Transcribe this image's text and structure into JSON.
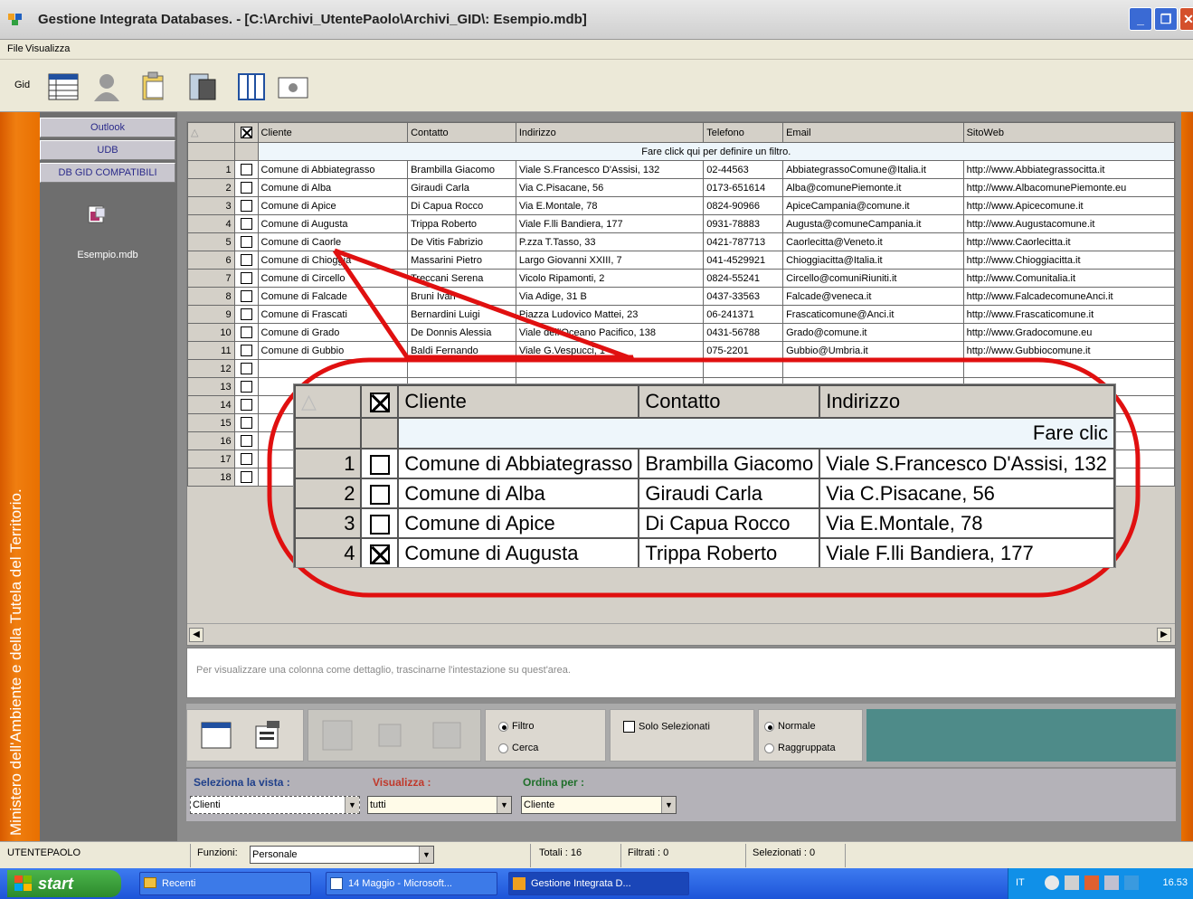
{
  "window": {
    "title": "Gestione Integrata Databases. - [C:\\Archivi_UtentePaolo\\Archivi_GID\\: Esempio.mdb]"
  },
  "menu": {
    "file": "File",
    "view": "Visualizza"
  },
  "toolbar": {
    "label": "Gid"
  },
  "sidebar": {
    "vertical_text": "Ministero dell'Ambiente e della Tutela del Territorio.",
    "buttons": [
      "Outlook",
      "UDB",
      "DB GID COMPATIBILI"
    ],
    "db_name": "Esempio.mdb"
  },
  "grid": {
    "columns": [
      "Cliente",
      "Contatto",
      "Indirizzo",
      "Telefono",
      "Email",
      "SitoWeb"
    ],
    "filter_text": "Fare click qui per definire un filtro.",
    "rows": [
      {
        "n": "1",
        "checked": false,
        "cliente": "Comune di Abbiategrasso",
        "contatto": "Brambilla Giacomo",
        "indirizzo": "Viale S.Francesco D'Assisi, 132",
        "telefono": "02-44563",
        "email": "AbbiategrassoComune@Italia.it",
        "sito": "http://www.Abbiategrassocitta.it"
      },
      {
        "n": "2",
        "checked": false,
        "cliente": "Comune di Alba",
        "contatto": "Giraudi Carla",
        "indirizzo": "Via C.Pisacane, 56",
        "telefono": "0173-651614",
        "email": "Alba@comunePiemonte.it",
        "sito": "http://www.AlbacomunePiemonte.eu"
      },
      {
        "n": "3",
        "checked": false,
        "cliente": "Comune di Apice",
        "contatto": "Di Capua Rocco",
        "indirizzo": "Via E.Montale, 78",
        "telefono": "0824-90966",
        "email": "ApiceCampania@comune.it",
        "sito": "http://www.Apicecomune.it"
      },
      {
        "n": "4",
        "checked": false,
        "cliente": "Comune di Augusta",
        "contatto": "Trippa Roberto",
        "indirizzo": "Viale F.lli Bandiera, 177",
        "telefono": "0931-78883",
        "email": "Augusta@comuneCampania.it",
        "sito": "http://www.Augustacomune.it"
      },
      {
        "n": "5",
        "checked": false,
        "cliente": "Comune di Caorle",
        "contatto": "De Vitis Fabrizio",
        "indirizzo": "P.zza T.Tasso, 33",
        "telefono": "0421-787713",
        "email": "Caorlecitta@Veneto.it",
        "sito": "http://www.Caorlecitta.it"
      },
      {
        "n": "6",
        "checked": false,
        "cliente": "Comune di Chioggia",
        "contatto": "Massarini Pietro",
        "indirizzo": "Largo Giovanni XXIII, 7",
        "telefono": "041-4529921",
        "email": "Chioggiacitta@Italia.it",
        "sito": "http://www.Chioggiacitta.it"
      },
      {
        "n": "7",
        "checked": false,
        "cliente": "Comune di Circello",
        "contatto": "Treccani Serena",
        "indirizzo": "Vicolo Ripamonti, 2",
        "telefono": "0824-55241",
        "email": "Circello@comuniRiuniti.it",
        "sito": "http://www.Comunitalia.it"
      },
      {
        "n": "8",
        "checked": false,
        "cliente": "Comune di Falcade",
        "contatto": "Bruni Ivan",
        "indirizzo": "Via Adige, 31 B",
        "telefono": "0437-33563",
        "email": "Falcade@veneca.it",
        "sito": "http://www.FalcadecomuneAnci.it"
      },
      {
        "n": "9",
        "checked": false,
        "cliente": "Comune di Frascati",
        "contatto": "Bernardini Luigi",
        "indirizzo": "Piazza Ludovico Mattei, 23",
        "telefono": "06-241371",
        "email": "Frascaticomune@Anci.it",
        "sito": "http://www.Frascaticomune.it"
      },
      {
        "n": "10",
        "checked": false,
        "cliente": "Comune di Grado",
        "contatto": "De Donnis Alessia",
        "indirizzo": "Viale dell'Oceano Pacifico, 138",
        "telefono": "0431-56788",
        "email": "Grado@comune.it",
        "sito": "http://www.Gradocomune.eu"
      },
      {
        "n": "11",
        "checked": false,
        "cliente": "Comune di Gubbio",
        "contatto": "Baldi Fernando",
        "indirizzo": "Viale G.Vespucci, 1",
        "telefono": "075-2201",
        "email": "Gubbio@Umbria.it",
        "sito": "http://www.Gubbiocomune.it"
      },
      {
        "n": "12",
        "checked": false,
        "cliente": "",
        "contatto": "",
        "indirizzo": "",
        "telefono": "",
        "email": "",
        "sito": ""
      },
      {
        "n": "13",
        "checked": false,
        "cliente": "",
        "contatto": "",
        "indirizzo": "",
        "telefono": "",
        "email": "",
        "sito": ""
      },
      {
        "n": "14",
        "checked": false,
        "cliente": "",
        "contatto": "",
        "indirizzo": "",
        "telefono": "",
        "email": "",
        "sito": ""
      },
      {
        "n": "15",
        "checked": false,
        "cliente": "",
        "contatto": "",
        "indirizzo": "",
        "telefono": "",
        "email": "",
        "sito": ""
      },
      {
        "n": "16",
        "checked": false,
        "cliente": "",
        "contatto": "",
        "indirizzo": "",
        "telefono": "",
        "email": "",
        "sito": ""
      },
      {
        "n": "17",
        "checked": false,
        "cliente": "",
        "contatto": "",
        "indirizzo": "",
        "telefono": "",
        "email": "",
        "sito": ""
      },
      {
        "n": "18",
        "checked": false,
        "cliente": "",
        "contatto": "",
        "indirizzo": "",
        "telefono": "",
        "email": "",
        "sito": ""
      }
    ]
  },
  "zoom": {
    "columns": [
      "Cliente",
      "Contatto",
      "Indirizzo"
    ],
    "filter_text": "Fare clic",
    "rows": [
      {
        "n": "1",
        "checked": false,
        "cliente": "Comune di Abbiategrasso",
        "contatto": "Brambilla Giacomo",
        "indirizzo": "Viale S.Francesco D'Assisi, 132"
      },
      {
        "n": "2",
        "checked": false,
        "cliente": "Comune di Alba",
        "contatto": "Giraudi Carla",
        "indirizzo": "Via C.Pisacane, 56"
      },
      {
        "n": "3",
        "checked": false,
        "cliente": "Comune di Apice",
        "contatto": "Di Capua Rocco",
        "indirizzo": "Via E.Montale, 78"
      },
      {
        "n": "4",
        "checked": true,
        "cliente": "Comune di Augusta",
        "contatto": "Trippa Roberto",
        "indirizzo": "Viale F.lli Bandiera, 177"
      }
    ]
  },
  "detail": {
    "hint": "Per visualizzare una colonna come dettaglio, trascinarne l'intestazione su quest'area."
  },
  "controls": {
    "filtro": "Filtro",
    "cerca": "Cerca",
    "solo_selezionati": "Solo Selezionati",
    "normale": "Normale",
    "raggruppata": "Raggruppata"
  },
  "vista": {
    "seleziona_label": "Seleziona la vista :",
    "visualizza_label": "Visualizza :",
    "ordina_label": "Ordina per :",
    "seleziona_value": "Clienti",
    "visualizza_value": "tutti",
    "ordina_value": "Cliente",
    "visualizza_color": "#c0392b",
    "label_color": "#1f3f8a"
  },
  "status": {
    "user": "UTENTEPAOLO",
    "funzioni_label": "Funzioni:",
    "funzioni_value": "Personale",
    "totali": "Totali : 16",
    "filtrati": "Filtrati : 0",
    "selezionati": "Selezionati : 0"
  },
  "taskbar": {
    "start": "start",
    "tasks": [
      "Recenti",
      "14 Maggio - Microsoft...",
      "Gestione Integrata D..."
    ],
    "clock": "16.53"
  }
}
